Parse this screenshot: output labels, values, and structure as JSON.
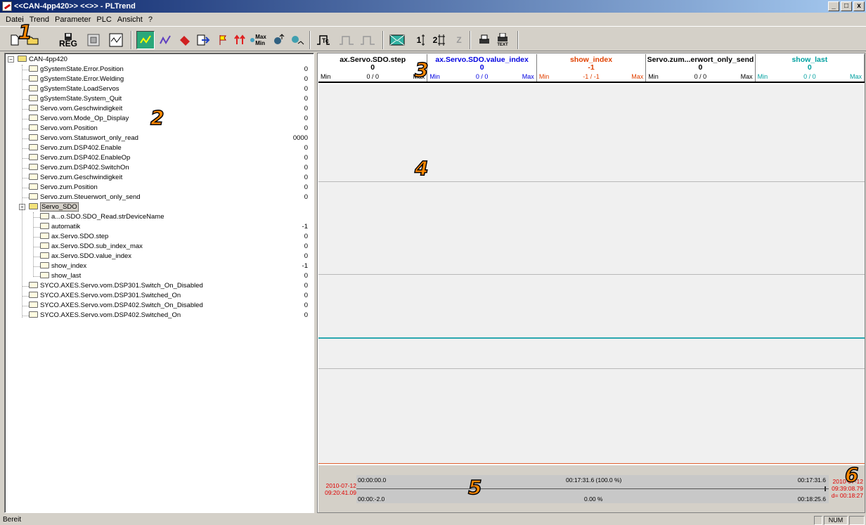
{
  "window": {
    "title": "<<CAN-4pp420>> <<>> - PLTrend",
    "min": "_",
    "max": "□",
    "close": "x"
  },
  "menu": [
    "Datei",
    "Trend",
    "Parameter",
    "PLC",
    "Ansicht",
    "?"
  ],
  "toolbar": {
    "reg_label": "REG",
    "maxmin_label": "Max\nMin",
    "text_label": "TEXT",
    "icons": [
      "new-icon",
      "open-icon",
      "save-reg-icon",
      "grid-icon",
      "window-icon",
      "trend-active-icon",
      "trend-edit-icon",
      "config-icon",
      "export-icon",
      "flag-icon",
      "arrows-icon",
      "maxmin-icon",
      "zoom-icon",
      "zoom-reset-icon",
      "trigger-icon",
      "pulse-icon",
      "pulse2-icon",
      "mail-icon",
      "one-icon",
      "two-icon",
      "z-icon",
      "print-icon",
      "print-text-icon"
    ]
  },
  "tree": {
    "root": "CAN-4pp420",
    "items": [
      {
        "label": "gSystemState.Error.Position",
        "value": "0"
      },
      {
        "label": "gSystemState.Error.Welding",
        "value": "0"
      },
      {
        "label": "gSystemState.LoadServos",
        "value": "0"
      },
      {
        "label": "gSystemState.System_Quit",
        "value": "0"
      },
      {
        "label": "Servo.vom.Geschwindigkeit",
        "value": "0"
      },
      {
        "label": "Servo.vom.Mode_Op_Display",
        "value": "0"
      },
      {
        "label": "Servo.vom.Position",
        "value": "0"
      },
      {
        "label": "Servo.vom.Statuswort_only_read",
        "value": "0000"
      },
      {
        "label": "Servo.zum.DSP402.Enable",
        "value": "0"
      },
      {
        "label": "Servo.zum.DSP402.EnableOp",
        "value": "0"
      },
      {
        "label": "Servo.zum.DSP402.SwitchOn",
        "value": "0"
      },
      {
        "label": "Servo.zum.Geschwindigkeit",
        "value": "0"
      },
      {
        "label": "Servo.zum.Position",
        "value": "0"
      },
      {
        "label": "Servo.zum.Steuerwort_only_send",
        "value": "0"
      }
    ],
    "group": "Servo_SDO",
    "group_items": [
      {
        "label": "a...o.SDO.SDO_Read.strDeviceName",
        "value": ""
      },
      {
        "label": "automatik",
        "value": "-1"
      },
      {
        "label": "ax.Servo.SDO.step",
        "value": "0"
      },
      {
        "label": "ax.Servo.SDO.sub_index_max",
        "value": "0"
      },
      {
        "label": "ax.Servo.SDO.value_index",
        "value": "0"
      },
      {
        "label": "show_index",
        "value": "-1"
      },
      {
        "label": "show_last",
        "value": "0"
      }
    ],
    "tail_items": [
      {
        "label": "SYCO.AXES.Servo.vom.DSP301.Switch_On_Disabled",
        "value": "0"
      },
      {
        "label": "SYCO.AXES.Servo.vom.DSP301.Switched_On",
        "value": "0"
      },
      {
        "label": "SYCO.AXES.Servo.vom.DSP402.Switch_On_Disabled",
        "value": "0"
      },
      {
        "label": "SYCO.AXES.Servo.vom.DSP402.Switched_On",
        "value": "0"
      }
    ]
  },
  "channels": [
    {
      "name": "ax.Servo.SDO.step",
      "value": "0",
      "min": "Min",
      "range": "0 /  0",
      "max": "Max",
      "color": "#000000"
    },
    {
      "name": "ax.Servo.SDO.value_index",
      "value": "0",
      "min": "Min",
      "range": "0 /  0",
      "max": "Max",
      "color": "#0000e0"
    },
    {
      "name": "show_index",
      "value": "-1",
      "min": "Min",
      "range": "-1 /  -1",
      "max": "Max",
      "color": "#e04000"
    },
    {
      "name": "Servo.zum...erwort_only_send",
      "value": "0",
      "min": "Min",
      "range": "0 /  0",
      "max": "Max",
      "color": "#000000"
    },
    {
      "name": "show_last",
      "value": "0",
      "min": "Min",
      "range": "0 /  0",
      "max": "Max",
      "color": "#00a0a0"
    }
  ],
  "colors": {
    "cyan_line": "#2aa8b0",
    "red_line": "#e06030"
  },
  "timebar": {
    "left_date": "2010-07-12",
    "left_time": "09:20:41.09",
    "start_top": "00:00:00.0",
    "start_bottom": "00:00:-2.0",
    "mid_top": "00:17:31.6 (100.0 %)",
    "mid_bottom": "0.00 %",
    "end_top": "00:17:31.6",
    "end_bottom": "00:18:25.6",
    "right_date": "2010-07-12",
    "right_time": "09:39:08.79",
    "right_delta": "d= 00:18:27"
  },
  "callouts": [
    "1",
    "2",
    "3",
    "4",
    "5",
    "6"
  ],
  "status": {
    "text": "Bereit",
    "num": "NUM"
  }
}
